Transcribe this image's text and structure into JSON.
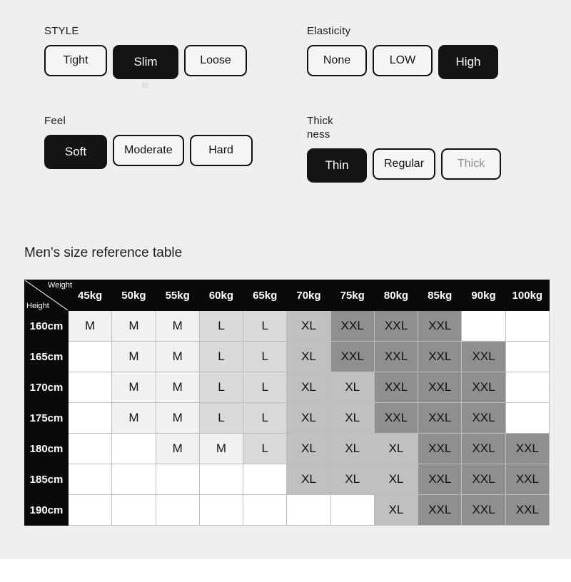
{
  "options": [
    {
      "id": "style",
      "label": "STYLE",
      "choices": [
        {
          "label": "Tight",
          "selected": false,
          "muted": false
        },
        {
          "label": "Slim",
          "selected": true,
          "muted": false,
          "note": "fit"
        },
        {
          "label": "Loose",
          "selected": false,
          "muted": false
        }
      ]
    },
    {
      "id": "elasticity",
      "label": "Elasticity",
      "choices": [
        {
          "label": "None",
          "selected": false,
          "muted": false
        },
        {
          "label": "LOW",
          "selected": false,
          "muted": false
        },
        {
          "label": "High",
          "selected": true,
          "muted": false
        }
      ]
    },
    {
      "id": "feel",
      "label": "Feel",
      "choices": [
        {
          "label": "Soft",
          "selected": true,
          "muted": false
        },
        {
          "label": "Moderate",
          "selected": false,
          "muted": false
        },
        {
          "label": "Hard",
          "selected": false,
          "muted": false
        }
      ]
    },
    {
      "id": "thickness",
      "label": "Thick\nness",
      "choices": [
        {
          "label": "Thin",
          "selected": true,
          "muted": false
        },
        {
          "label": "Regular",
          "selected": false,
          "muted": false
        },
        {
          "label": "Thick",
          "selected": false,
          "muted": true
        }
      ]
    }
  ],
  "table": {
    "title": "Men's size reference table",
    "corner": {
      "weight_label": "Weight",
      "height_label": "Height"
    },
    "columns": [
      "45kg",
      "50kg",
      "55kg",
      "60kg",
      "65kg",
      "70kg",
      "75kg",
      "80kg",
      "85kg",
      "90kg",
      "100kg"
    ],
    "rows": [
      {
        "height": "160cm",
        "cells": [
          "M",
          "M",
          "M",
          "L",
          "L",
          "XL",
          "XXL",
          "XXL",
          "XXL",
          "",
          ""
        ]
      },
      {
        "height": "165cm",
        "cells": [
          "",
          "M",
          "M",
          "L",
          "L",
          "XL",
          "XXL",
          "XXL",
          "XXL",
          "XXL",
          ""
        ]
      },
      {
        "height": "170cm",
        "cells": [
          "",
          "M",
          "M",
          "L",
          "L",
          "XL",
          "XL",
          "XXL",
          "XXL",
          "XXL",
          ""
        ]
      },
      {
        "height": "175cm",
        "cells": [
          "",
          "M",
          "M",
          "L",
          "L",
          "XL",
          "XL",
          "XXL",
          "XXL",
          "XXL",
          ""
        ]
      },
      {
        "height": "180cm",
        "cells": [
          "",
          "",
          "M",
          "M",
          "L",
          "XL",
          "XL",
          "XL",
          "XXL",
          "XXL",
          "XXL"
        ]
      },
      {
        "height": "185cm",
        "cells": [
          "",
          "",
          "",
          "",
          "",
          "XL",
          "XL",
          "XL",
          "XXL",
          "XXL",
          "XXL"
        ]
      },
      {
        "height": "190cm",
        "cells": [
          "",
          "",
          "",
          "",
          "",
          "",
          "",
          "XL",
          "XXL",
          "XXL",
          "XXL"
        ]
      }
    ]
  },
  "colors": {
    "background": "#efefef",
    "selected_chip": "#141414",
    "chip_border": "#111111",
    "header_black": "#0a0a0a",
    "shade_M": "#f1f1f1",
    "shade_L": "#d9d9d9",
    "shade_XL": "#c0c0c0",
    "shade_XXL": "#8f8f8f"
  }
}
